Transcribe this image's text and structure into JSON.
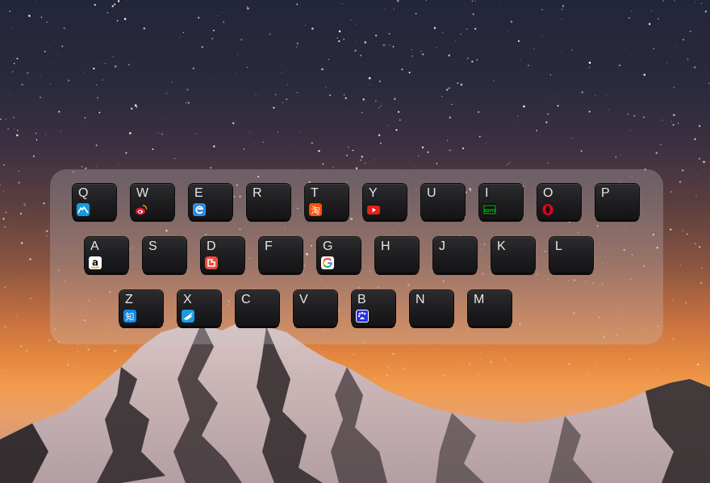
{
  "rows": [
    {
      "keys": [
        {
          "letter": "Q",
          "icon": "alibaba-camel-icon"
        },
        {
          "letter": "W",
          "icon": "weibo-icon"
        },
        {
          "letter": "E",
          "icon": "edge-browser-icon"
        },
        {
          "letter": "R",
          "icon": null
        },
        {
          "letter": "T",
          "icon": "taobao-icon"
        },
        {
          "letter": "Y",
          "icon": "youtube-icon"
        },
        {
          "letter": "U",
          "icon": null
        },
        {
          "letter": "I",
          "icon": "iqiyi-icon"
        },
        {
          "letter": "O",
          "icon": "opera-icon"
        },
        {
          "letter": "P",
          "icon": null
        }
      ]
    },
    {
      "keys": [
        {
          "letter": "A",
          "icon": "amazon-icon"
        },
        {
          "letter": "S",
          "icon": null
        },
        {
          "letter": "D",
          "icon": "douyu-icon"
        },
        {
          "letter": "F",
          "icon": null
        },
        {
          "letter": "G",
          "icon": "google-icon"
        },
        {
          "letter": "H",
          "icon": null
        },
        {
          "letter": "J",
          "icon": null
        },
        {
          "letter": "K",
          "icon": null
        },
        {
          "letter": "L",
          "icon": null
        }
      ]
    },
    {
      "keys": [
        {
          "letter": "Z",
          "icon": "zhihu-icon"
        },
        {
          "letter": "X",
          "icon": "xunlei-icon"
        },
        {
          "letter": "C",
          "icon": null
        },
        {
          "letter": "V",
          "icon": null
        },
        {
          "letter": "B",
          "icon": "baidu-icon"
        },
        {
          "letter": "N",
          "icon": null
        },
        {
          "letter": "M",
          "icon": null
        }
      ]
    }
  ],
  "icon_text": {
    "taobao": "淘",
    "iqiyi": "iQIYI",
    "zhihu": "知",
    "amazon": "a"
  },
  "colors": {
    "key_background": "#1c1c1e",
    "key_letter": "#e6e6e6",
    "panel": "rgba(200,200,210,0.28)",
    "youtube": "#e62117",
    "weibo": "#e6162d",
    "edge": "#2f8de4",
    "taobao": "#ff5000",
    "iqiyi": "#00be06",
    "opera": "#e8001c",
    "douyu": "#f04a3a",
    "zhihu": "#0f88eb",
    "xunlei": "#1a9ae6",
    "baidu": "#2932e1",
    "alibaba": "#139ee0"
  }
}
